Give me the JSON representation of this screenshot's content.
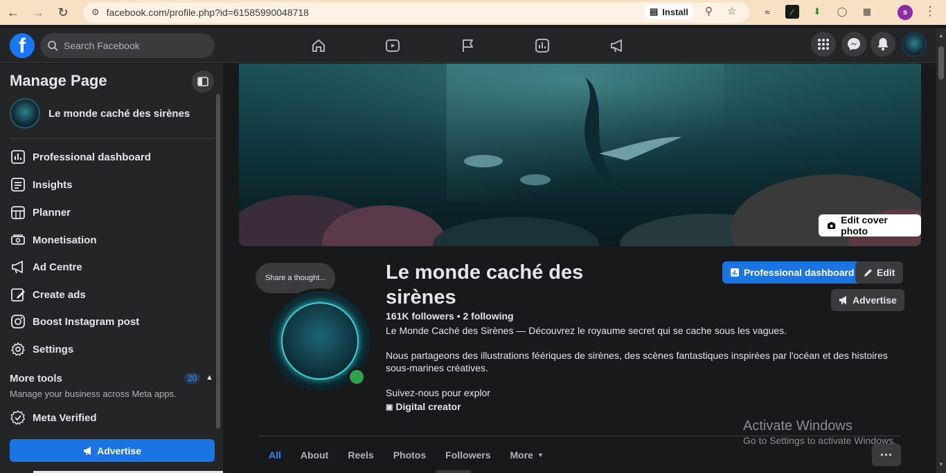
{
  "browser": {
    "url": "facebook.com/profile.php?id=61585990048718",
    "install_label": "Install",
    "profile_initial": "s"
  },
  "topnav": {
    "search_placeholder": "Search Facebook",
    "logo_letter": "f"
  },
  "sidebar": {
    "title": "Manage Page",
    "page_name": "Le monde caché des sirènes",
    "items": [
      {
        "label": "Professional dashboard",
        "icon": "dashboard-icon"
      },
      {
        "label": "Insights",
        "icon": "insights-icon"
      },
      {
        "label": "Planner",
        "icon": "planner-icon"
      },
      {
        "label": "Monetisation",
        "icon": "monetisation-icon"
      },
      {
        "label": "Ad Centre",
        "icon": "megaphone-icon"
      },
      {
        "label": "Create ads",
        "icon": "pencil-icon"
      },
      {
        "label": "Boost Instagram post",
        "icon": "instagram-icon"
      },
      {
        "label": "Settings",
        "icon": "gear-icon"
      }
    ],
    "more_tools": {
      "title": "More tools",
      "badge": "20",
      "subtitle": "Manage your business across Meta apps."
    },
    "meta_verified": "Meta Verified",
    "advertise": "Advertise"
  },
  "profile": {
    "edit_cover": "Edit cover photo",
    "thought": "Share a thought...",
    "name": "Le monde caché des sirènes",
    "followers": "161K followers • 2 following",
    "bio_1": "Le Monde Caché des Sirènes — Découvrez le royaume secret qui se cache sous les vagues.",
    "bio_2": "Nous partageons des illustrations féériques de sirènes, des scènes fantastiques inspirées par l'océan et des histoires sous-marines créatives.",
    "bio_3": "Suivez-nous pour explor",
    "category": "Digital creator",
    "btn_dashboard": "Professional dashboard",
    "btn_edit": "Edit",
    "btn_advertise": "Advertise",
    "tabs": [
      "All",
      "About",
      "Reels",
      "Photos",
      "Followers",
      "More"
    ],
    "more_dots": "···"
  },
  "watermark": {
    "line1": "Activate Windows",
    "line2": "Go to Settings to activate Windows."
  }
}
